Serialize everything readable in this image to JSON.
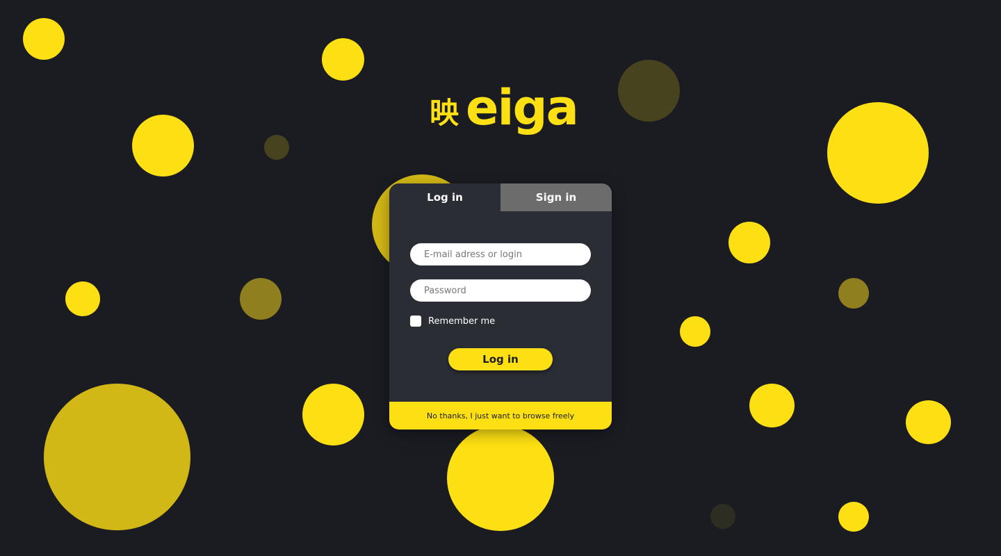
{
  "brand": {
    "kanji": "映",
    "name": "eiga",
    "accent_color": "#fde013",
    "background_color": "#1b1c22"
  },
  "auth_card": {
    "tabs": [
      {
        "label": "Log in",
        "active": true
      },
      {
        "label": "Sign in",
        "active": false
      }
    ],
    "email": {
      "value": "",
      "placeholder": "E-mail adress or login"
    },
    "password": {
      "value": "",
      "placeholder": "Password"
    },
    "remember_me": {
      "label": "Remember me",
      "checked": false
    },
    "submit_label": "Log in",
    "browse_link": "No thanks, I just want to browse freely"
  }
}
